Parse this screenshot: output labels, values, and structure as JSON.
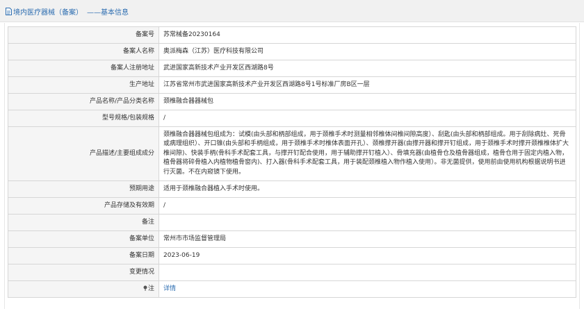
{
  "header": {
    "breadcrumb_label": "境内医疗器械（备案）",
    "breadcrumb_suffix": "——基本信息",
    "accent_color": "#2b6cb0"
  },
  "record": {
    "rows": [
      {
        "label": "备案号",
        "value": "苏常械备20230164"
      },
      {
        "label": "备案人名称",
        "value": "奥派梅森（江苏）医疗科技有限公司"
      },
      {
        "label": "备案人注册地址",
        "value": "武进国家高新技术产业开发区西湖路8号"
      },
      {
        "label": "生产地址",
        "value": "江苏省常州市武进国家高新技术产业开发区西湖路8号1号标准厂房B区一层"
      },
      {
        "label": "产品名称/产品分类名称",
        "value": "颈椎融合器器械包"
      },
      {
        "label": "型号规格/包装规格",
        "value": "/"
      },
      {
        "label": "产品描述/主要组成成分",
        "value": "颈椎融合器器械包组成为：试模(由头部和柄部组成，用于颈椎手术时测量相邻椎体间椎间隙高度）、刮匙(由头部和柄部组成。用于刮除病灶、死骨或病理组织）、开口锥(由头部和手柄组成，用于颈椎手术时椎体表面开孔）、颈椎撑开器(由撑开器和撑开钉组成，用于颈椎手术时撑开颈椎椎体扩大椎间隙)、快装手柄(骨科手术配套工具，与撑开钉配合使用，用于辅助撑开钉植入）、骨填充器(由植骨仓及植骨器组成，植骨仓用于固定内植入物，植骨器将碎骨植入内植物植骨窗内)、打入器(骨科手术配套工具，用于装配颈椎植入物作植入使用）。非无菌提供，使用前由使用机构根据说明书进行灭菌。不在内窥镜下使用。"
      },
      {
        "label": "预期用途",
        "value": "适用于颈椎融合器植入手术时使用。"
      },
      {
        "label": "产品存储及有效期",
        "value": "/"
      },
      {
        "label": "备注",
        "value": ""
      },
      {
        "label": "备案单位",
        "value": "常州市市场监督管理局"
      },
      {
        "label": "备案日期",
        "value": "2023-06-19"
      },
      {
        "label": "变更情况",
        "value": ""
      }
    ],
    "note_label": "注",
    "note_link": "详情"
  }
}
